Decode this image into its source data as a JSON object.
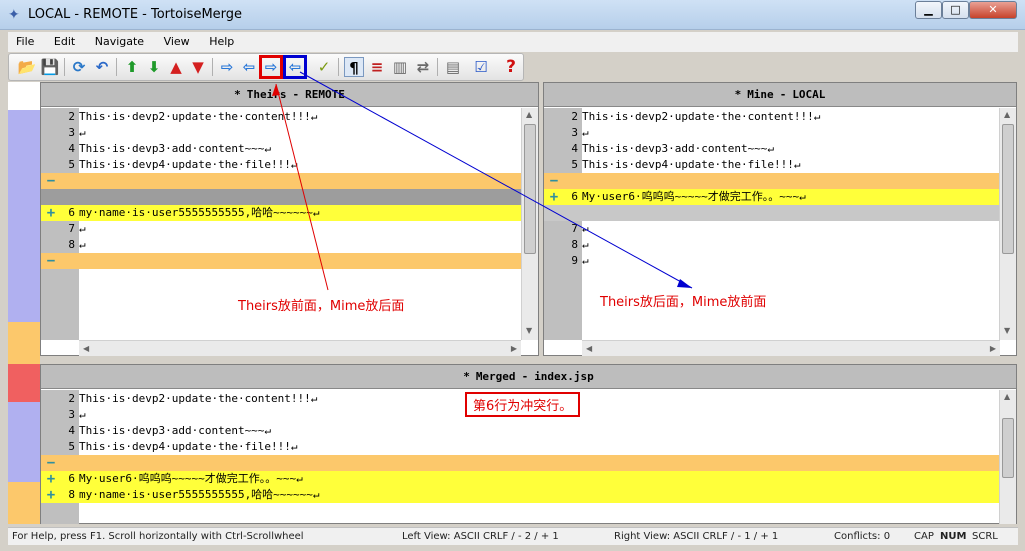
{
  "window": {
    "title": "LOCAL - REMOTE - TortoiseMerge",
    "min_label": "▁",
    "max_label": "□",
    "close_label": "✕"
  },
  "menu": [
    "File",
    "Edit",
    "Navigate",
    "View",
    "Help"
  ],
  "toolbar": {
    "icons": [
      "open-icon",
      "save-icon",
      "reload-icon",
      "undo-icon",
      "prev-diff-icon",
      "next-diff-icon",
      "prev-conflict-icon",
      "next-conflict-icon",
      "use-theirs-icon",
      "use-mine-icon",
      "theirs-before-mine-icon",
      "mine-before-theirs-icon",
      "mark-resolved-icon",
      "whitespace-icon",
      "inline-diff-icon",
      "one-pane-icon",
      "switch-icon",
      "patch-icon",
      "settings-icon",
      "help-icon"
    ],
    "glyphs": [
      "📂",
      "💾",
      "⟳",
      "↶",
      "⬆",
      "⬇",
      "▲",
      "▼",
      "⇨",
      "⇦",
      "⇨",
      "⇦",
      "✓",
      "¶",
      "≡",
      "▥",
      "⇄",
      "▤",
      "☑",
      "?"
    ]
  },
  "left_pane": {
    "star": "*",
    "name": "Theirs",
    "sep": "-",
    "file": "REMOTE",
    "lines": [
      {
        "num": "2",
        "mark": "",
        "text": "This·is·devp2·update·the·content!!!↵",
        "style": ""
      },
      {
        "num": "3",
        "mark": "",
        "text": "↵",
        "style": ""
      },
      {
        "num": "4",
        "mark": "",
        "text": "This·is·devp3·add·content~~~↵",
        "style": ""
      },
      {
        "num": "5",
        "mark": "",
        "text": "This·is·devp4·update·the·file!!!↵",
        "style": ""
      },
      {
        "num": "",
        "mark": "−",
        "text": "",
        "style": "orange"
      },
      {
        "num": "",
        "mark": "",
        "text": "",
        "style": "grayline"
      },
      {
        "num": "6",
        "mark": "+",
        "text": "my·name·is·user5555555555,哈哈~~~~~~↵",
        "style": "yellow"
      },
      {
        "num": "7",
        "mark": "",
        "text": "↵",
        "style": ""
      },
      {
        "num": "8",
        "mark": "",
        "text": "↵",
        "style": ""
      },
      {
        "num": "",
        "mark": "−",
        "text": "",
        "style": "orange"
      }
    ]
  },
  "right_pane": {
    "star": "*",
    "name": "Mine",
    "sep": "-",
    "file": "LOCAL",
    "lines": [
      {
        "num": "2",
        "mark": "",
        "text": "This·is·devp2·update·the·content!!!↵",
        "style": ""
      },
      {
        "num": "3",
        "mark": "",
        "text": "↵",
        "style": ""
      },
      {
        "num": "4",
        "mark": "",
        "text": "This·is·devp3·add·content~~~↵",
        "style": ""
      },
      {
        "num": "5",
        "mark": "",
        "text": "This·is·devp4·update·the·file!!!↵",
        "style": ""
      },
      {
        "num": "",
        "mark": "−",
        "text": "",
        "style": "orange"
      },
      {
        "num": "6",
        "mark": "+",
        "text": "My·user6·呜呜呜~~~~~才做完工作。。~~~↵",
        "style": "yellow"
      },
      {
        "num": "",
        "mark": "",
        "text": "",
        "style": "gray"
      },
      {
        "num": "7",
        "mark": "",
        "text": "↵",
        "style": ""
      },
      {
        "num": "8",
        "mark": "",
        "text": "↵",
        "style": ""
      },
      {
        "num": "9",
        "mark": "",
        "text": "↵",
        "style": ""
      }
    ]
  },
  "merged_pane": {
    "star": "*",
    "name": "Merged",
    "sep": "-",
    "file": "index.jsp",
    "lines": [
      {
        "num": "2",
        "mark": "",
        "text": "This·is·devp2·update·the·content!!!↵",
        "style": ""
      },
      {
        "num": "3",
        "mark": "",
        "text": "↵",
        "style": ""
      },
      {
        "num": "4",
        "mark": "",
        "text": "This·is·devp3·add·content~~~↵",
        "style": ""
      },
      {
        "num": "5",
        "mark": "",
        "text": "This·is·devp4·update·the·file!!!↵",
        "style": ""
      },
      {
        "num": "",
        "mark": "−",
        "text": "",
        "style": "orange"
      },
      {
        "num": "6",
        "mark": "+",
        "text": "My·user6·呜呜呜~~~~~才做完工作。。~~~↵",
        "style": "yellow"
      },
      {
        "num": "8",
        "mark": "+",
        "text": "my·name·is·user5555555555,哈哈~~~~~~↵",
        "style": "yellow"
      }
    ]
  },
  "annotations": {
    "theirs_first": "Theirs放前面，Mime放后面",
    "theirs_last": "Theirs放后面，Mime放前面",
    "conflict_note": "第6行为冲突行。"
  },
  "status": {
    "help": "For Help, press F1. Scroll horizontally with Ctrl-Scrollwheel",
    "left_view": "Left View: ASCII CRLF  / - 2 / + 1",
    "right_view": "Right View: ASCII CRLF  / - 1 / + 1",
    "conflicts": "Conflicts: 0",
    "cap": "CAP",
    "num": "NUM",
    "scrl": "SCRL"
  },
  "colors": {
    "removed": "#fcc86b",
    "added": "#ffff3a",
    "annotation_red": "#e00000",
    "annotation_blue": "#0000d0"
  }
}
